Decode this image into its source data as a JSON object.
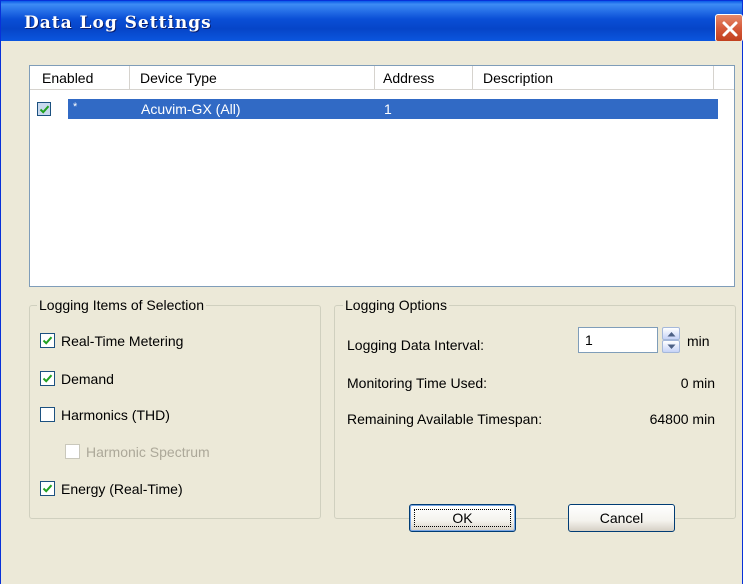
{
  "window": {
    "title": "Data Log Settings",
    "close_icon": "close-icon"
  },
  "device_list": {
    "columns": [
      "Enabled",
      "Device Type",
      "Address",
      "Description"
    ],
    "rows": [
      {
        "enabled": true,
        "marker": "*",
        "device_type": "Acuvim-GX (All)",
        "address": "1",
        "description": ""
      }
    ]
  },
  "logging_items": {
    "legend": "Logging Items of Selection",
    "items": [
      {
        "label": "Real-Time Metering",
        "checked": true,
        "enabled": true
      },
      {
        "label": "Demand",
        "checked": true,
        "enabled": true
      },
      {
        "label": "Harmonics (THD)",
        "checked": false,
        "enabled": true
      },
      {
        "label": "Harmonic Spectrum",
        "checked": false,
        "enabled": false
      },
      {
        "label": "Energy (Real-Time)",
        "checked": true,
        "enabled": true
      }
    ]
  },
  "logging_options": {
    "legend": "Logging Options",
    "interval_label": "Logging Data Interval:",
    "interval_value": "1",
    "interval_unit": "min",
    "monitoring_label": "Monitoring Time Used:",
    "monitoring_value": "0 min",
    "remaining_label": "Remaining Available Timespan:",
    "remaining_value": "64800 min"
  },
  "buttons": {
    "ok": "OK",
    "cancel": "Cancel"
  },
  "colors": {
    "titlebar": "#0a4fd6",
    "selection": "#316ac5",
    "dialog_bg": "#ece9d8"
  }
}
